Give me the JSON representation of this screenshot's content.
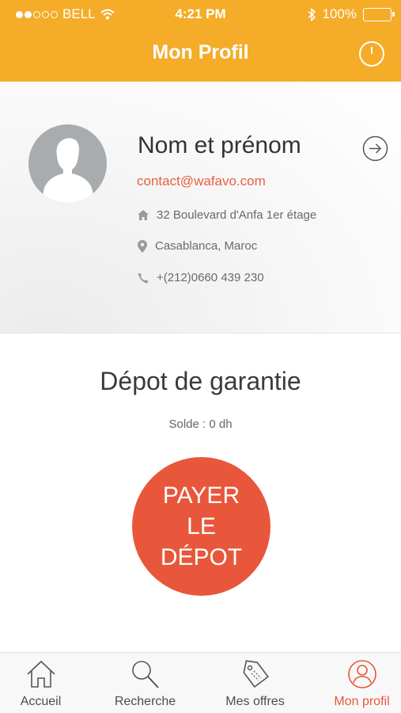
{
  "status_bar": {
    "carrier": "BELL",
    "time": "4:21 PM",
    "battery": "100%",
    "signal_icon": "signal-dots-icon",
    "wifi_icon": "wifi-icon",
    "bluetooth_icon": "bluetooth-icon"
  },
  "nav": {
    "title": "Mon Profil",
    "power_icon": "power-icon"
  },
  "profile": {
    "name": "Nom et prénom",
    "email": "contact@wafavo.com",
    "address": "32 Boulevard d'Anfa 1er étage",
    "city": "Casablanca, Maroc",
    "phone": "+(212)0660 439 230",
    "avatar_icon": "avatar-placeholder-icon",
    "arrow_icon": "arrow-right-circle-icon"
  },
  "deposit": {
    "title": "Dépot de garantie",
    "balance": "Solde : 0 dh",
    "button_line1": "PAYER",
    "button_line2": "LE",
    "button_line3": "DÉPOT"
  },
  "tabbar": {
    "tabs": [
      {
        "label": "Accueil",
        "icon": "home-icon",
        "active": false
      },
      {
        "label": "Recherche",
        "icon": "search-icon",
        "active": false
      },
      {
        "label": "Mes offres",
        "icon": "tag-icon",
        "active": false
      },
      {
        "label": "Mon profil",
        "icon": "profile-icon",
        "active": true
      }
    ]
  },
  "colors": {
    "header": "#F5AC28",
    "accent": "#E8573B",
    "email": "#E8603F",
    "avatar_bg": "#A9ACAE"
  }
}
